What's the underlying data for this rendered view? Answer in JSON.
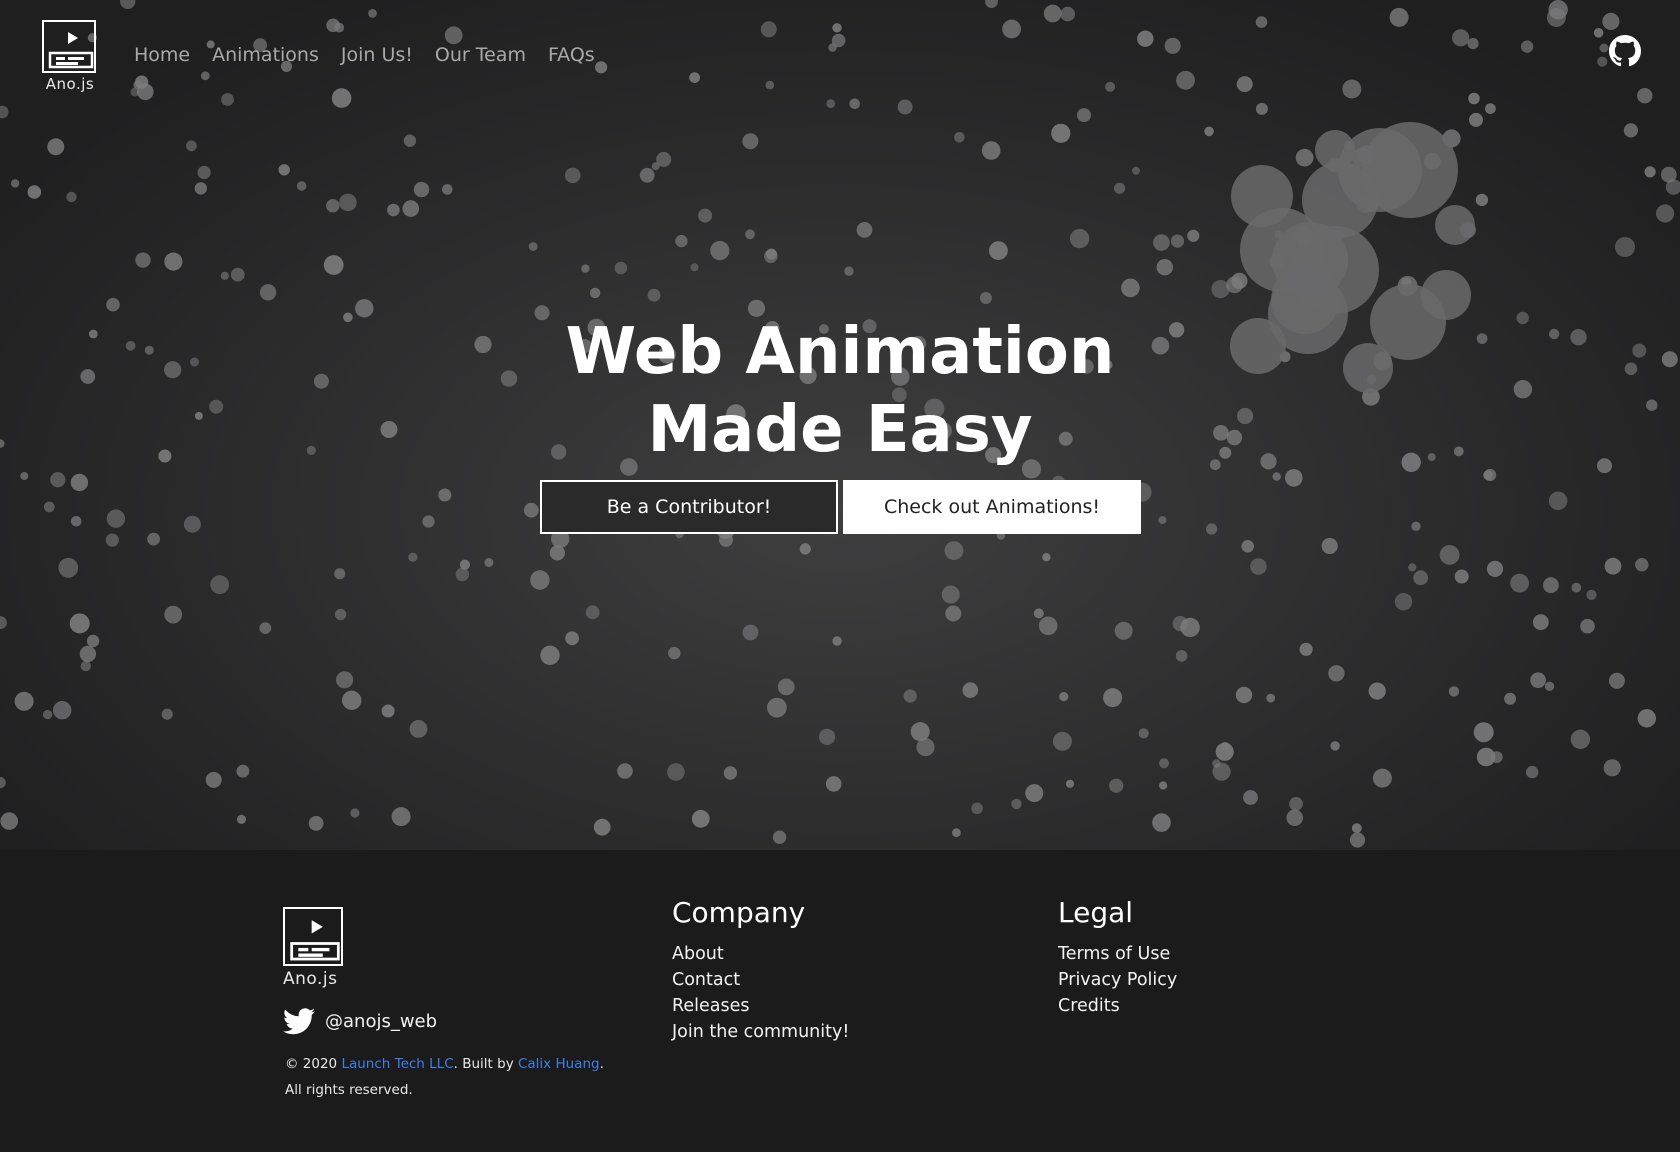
{
  "brand": {
    "name": "Ano.js"
  },
  "nav": {
    "items": [
      "Home",
      "Animations",
      "Join Us!",
      "Our Team",
      "FAQs"
    ]
  },
  "header": {
    "github_icon": "github-icon"
  },
  "hero": {
    "title_line1": "Web Animation",
    "title_line2": "Made Easy",
    "primary_button": "Be a Contributor!",
    "secondary_button": "Check out Animations!"
  },
  "footer": {
    "twitter_handle": "@anojs_web",
    "copyright_prefix": "© 2020 ",
    "company_link": "Launch Tech LLC",
    "built_by": ". Built by ",
    "author_link": "Calix Huang",
    "rights": ". All rights reserved.",
    "company": {
      "heading": "Company",
      "links": [
        "About",
        "Contact",
        "Releases",
        "Join the community!"
      ]
    },
    "legal": {
      "heading": "Legal",
      "links": [
        "Terms of Use",
        "Privacy Policy",
        "Credits"
      ]
    }
  },
  "colors": {
    "background": "#1b1b1c",
    "link_accent": "#3d7fe8",
    "particle": "#8a8a8a"
  }
}
